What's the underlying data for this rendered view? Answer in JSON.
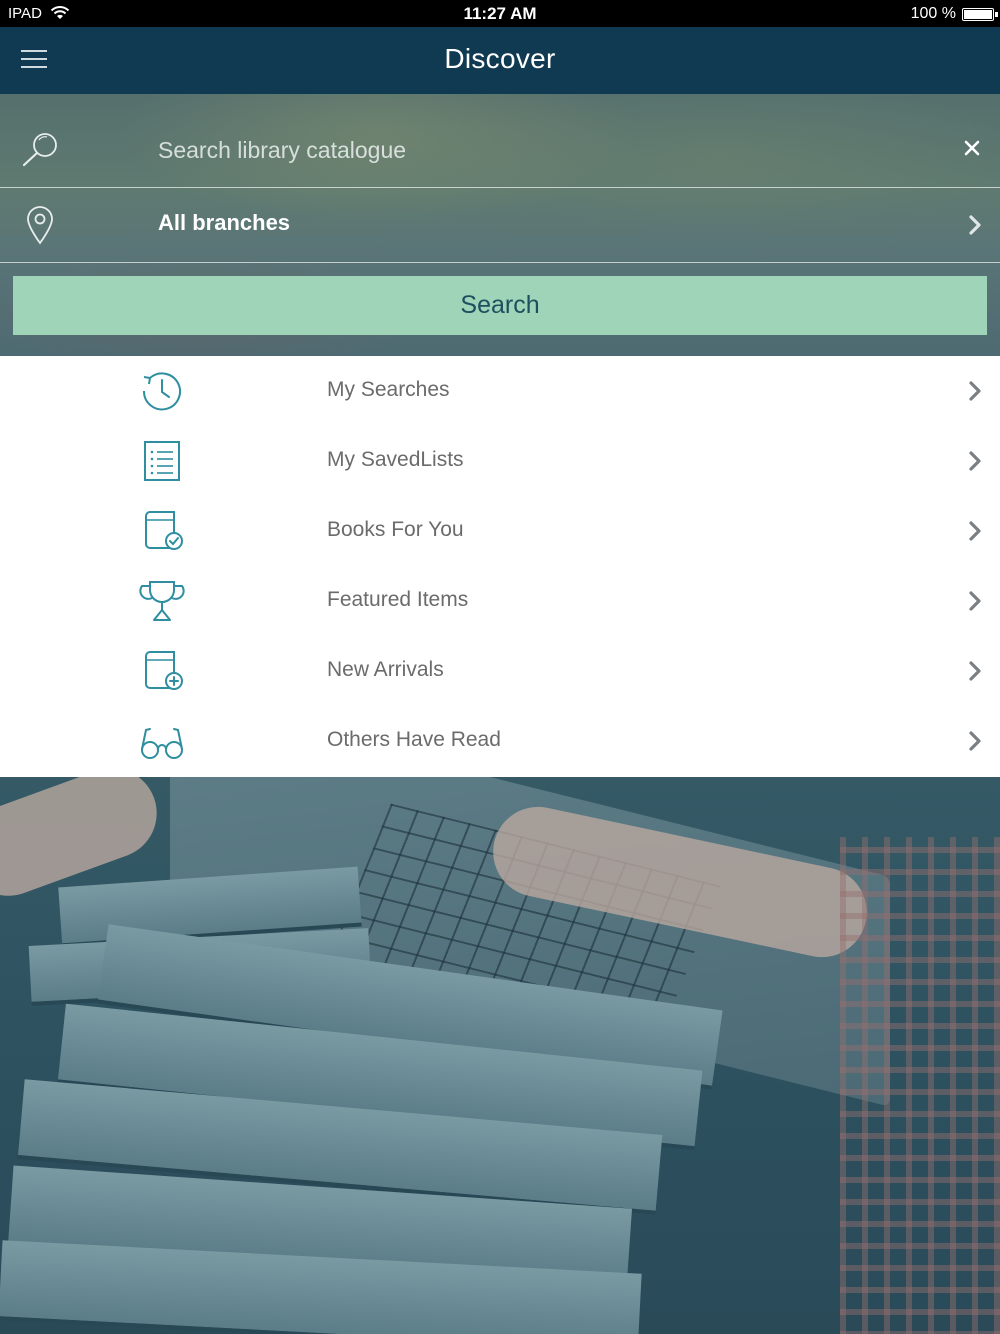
{
  "status_bar": {
    "carrier": "IPAD",
    "time": "11:27 AM",
    "battery_text": "100 %",
    "battery_level": 1.0
  },
  "nav": {
    "title": "Discover",
    "menu_icon": "hamburger-icon"
  },
  "search": {
    "placeholder": "Search library catalogue",
    "value": "",
    "search_icon": "magnifier-icon",
    "clear_icon": "close-icon"
  },
  "branch": {
    "label": "All branches",
    "icon": "location-pin-icon"
  },
  "search_button": {
    "label": "Search"
  },
  "menu_items": [
    {
      "label": "My Searches",
      "icon": "history-clock-icon"
    },
    {
      "label": "My SavedLists",
      "icon": "list-document-icon"
    },
    {
      "label": "Books For You",
      "icon": "book-check-icon"
    },
    {
      "label": "Featured Items",
      "icon": "trophy-icon"
    },
    {
      "label": "New Arrivals",
      "icon": "book-plus-icon"
    },
    {
      "label": "Others Have Read",
      "icon": "glasses-icon"
    }
  ],
  "colors": {
    "nav_bg": "#0f3a52",
    "accent_button": "#9fd4b9",
    "icon_teal": "#2f8ea0",
    "list_text": "#6b6b6b"
  }
}
